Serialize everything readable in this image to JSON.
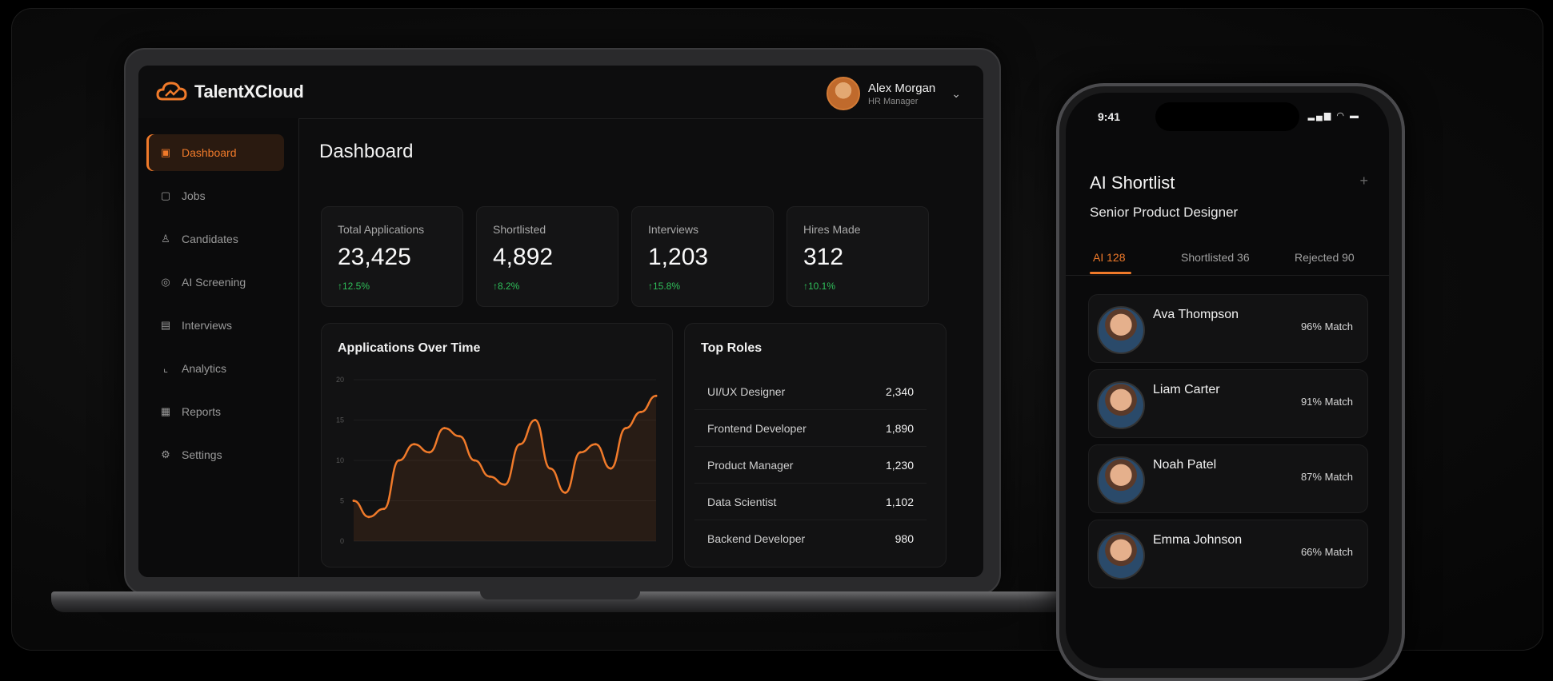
{
  "brand": {
    "name": "TalentXCloud",
    "accent": "#f07a2a"
  },
  "user": {
    "name": "Alex Morgan",
    "role": "HR Manager"
  },
  "sidebar": {
    "items": [
      {
        "label": "Dashboard",
        "icon": "dashboard-icon",
        "active": true
      },
      {
        "label": "Jobs",
        "icon": "briefcase-icon"
      },
      {
        "label": "Candidates",
        "icon": "user-icon"
      },
      {
        "label": "AI Screening",
        "icon": "ai-icon"
      },
      {
        "label": "Interviews",
        "icon": "calendar-icon"
      },
      {
        "label": "Analytics",
        "icon": "analytics-icon"
      },
      {
        "label": "Reports",
        "icon": "report-icon"
      },
      {
        "label": "Settings",
        "icon": "gear-icon"
      }
    ]
  },
  "main": {
    "title": "Dashboard",
    "stats": [
      {
        "label": "Total Applications",
        "value": "23,425",
        "delta": "↑12.5%"
      },
      {
        "label": "Shortlisted",
        "value": "4,892",
        "delta": "↑8.2%"
      },
      {
        "label": "Interviews",
        "value": "1,203",
        "delta": "↑15.8%"
      },
      {
        "label": "Hires Made",
        "value": "312",
        "delta": "↑10.1%"
      }
    ],
    "chart_title": "Applications Over Time",
    "top_roles_title": "Top Roles",
    "top_roles": [
      {
        "role": "UI/UX Designer",
        "count": "2,340"
      },
      {
        "role": "Frontend Developer",
        "count": "1,890"
      },
      {
        "role": "Product Manager",
        "count": "1,230"
      },
      {
        "role": "Data Scientist",
        "count": "1,102"
      },
      {
        "role": "Backend Developer",
        "count": "980"
      }
    ]
  },
  "chart_data": {
    "type": "line",
    "title": "Applications Over Time",
    "yticks": [
      "20",
      "15",
      "10",
      "5",
      "0"
    ],
    "ylim": [
      0,
      20
    ],
    "x": [
      0,
      1,
      2,
      3,
      4,
      5,
      6,
      7,
      8,
      9,
      10,
      11,
      12,
      13,
      14,
      15,
      16,
      17,
      18,
      19,
      20
    ],
    "series": [
      {
        "values": [
          5,
          3,
          4,
          10,
          12,
          11,
          14,
          13,
          10,
          8,
          7,
          12,
          15,
          9,
          6,
          11,
          12,
          9,
          14,
          16,
          18
        ],
        "color": "#f07a2a"
      }
    ]
  },
  "phone": {
    "time": "9:41",
    "status": "▂▄▆ ◠ ▬",
    "title": "AI Shortlist",
    "subtitle": "Senior Product Designer",
    "tabs": [
      {
        "label": "AI 128",
        "active": true
      },
      {
        "label": "Shortlisted 36"
      },
      {
        "label": "Rejected 90"
      }
    ],
    "candidates": [
      {
        "name": "Ava Thompson",
        "match": "96% Match"
      },
      {
        "name": "Liam Carter",
        "match": "91% Match"
      },
      {
        "name": "Noah Patel",
        "match": "87% Match"
      },
      {
        "name": "Emma Johnson",
        "match": "66% Match"
      }
    ]
  }
}
